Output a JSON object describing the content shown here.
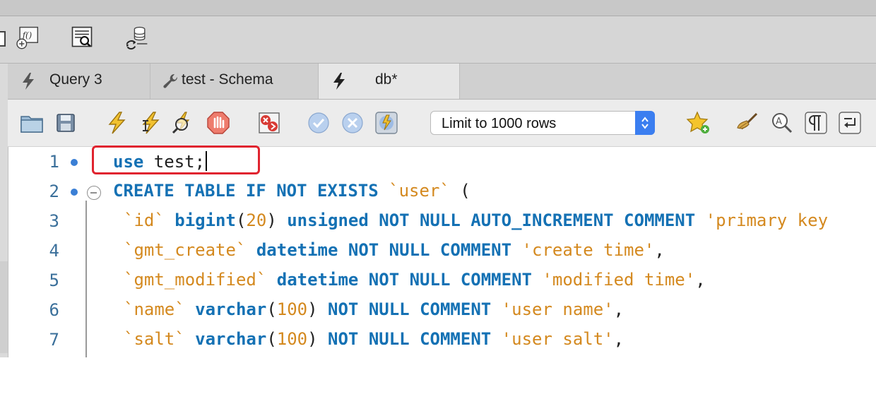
{
  "tabs": [
    {
      "label": "Query 3",
      "icon": "lightning-icon",
      "active": false
    },
    {
      "label": "test - Schema",
      "icon": "wrench-icon",
      "active": false
    },
    {
      "label": "db*",
      "icon": "lightning-icon",
      "active": true
    }
  ],
  "query_toolbar": {
    "limit_select": {
      "selected": "Limit to 1000 rows"
    }
  },
  "editor": {
    "lines": [
      {
        "number": "1",
        "breakpoint": true
      },
      {
        "number": "2",
        "breakpoint": true
      },
      {
        "number": "3",
        "breakpoint": false
      },
      {
        "number": "4",
        "breakpoint": false
      },
      {
        "number": "5",
        "breakpoint": false
      },
      {
        "number": "6",
        "breakpoint": false
      },
      {
        "number": "7",
        "breakpoint": false
      }
    ],
    "code": {
      "l1": {
        "kw": "use",
        "rest": " test;"
      },
      "l2": {
        "kw": "CREATE TABLE IF NOT EXISTS",
        "bt": "`user`",
        "rest": " ("
      },
      "l3": {
        "bt": "`id`",
        "kw1": "bigint",
        "p1": "(",
        "num": "20",
        "p2": ")",
        "kw2": "unsigned NOT NULL AUTO_INCREMENT COMMENT",
        "str": "'primary key"
      },
      "l4": {
        "bt": "`gmt_create`",
        "kw": "datetime NOT NULL COMMENT",
        "str": "'create time'",
        "end": ","
      },
      "l5": {
        "bt": "`gmt_modified`",
        "kw": "datetime NOT NULL COMMENT",
        "str": "'modified time'",
        "end": ","
      },
      "l6": {
        "bt": "`name`",
        "kw1": "varchar",
        "p1": "(",
        "num": "100",
        "p2": ")",
        "kw2": "NOT NULL COMMENT",
        "str": "'user name'",
        "end": ","
      },
      "l7": {
        "bt": "`salt`",
        "kw1": "varchar",
        "p1": "(",
        "num": "100",
        "p2": ")",
        "kw2": "NOT NULL COMMENT",
        "str": "'user salt'",
        "end": ","
      }
    }
  },
  "colors": {
    "keyword": "#1471b4",
    "string": "#d4891f",
    "line_number": "#3a6f9a",
    "highlight_border": "#e0242f",
    "stepper": "#3b7ef0"
  }
}
